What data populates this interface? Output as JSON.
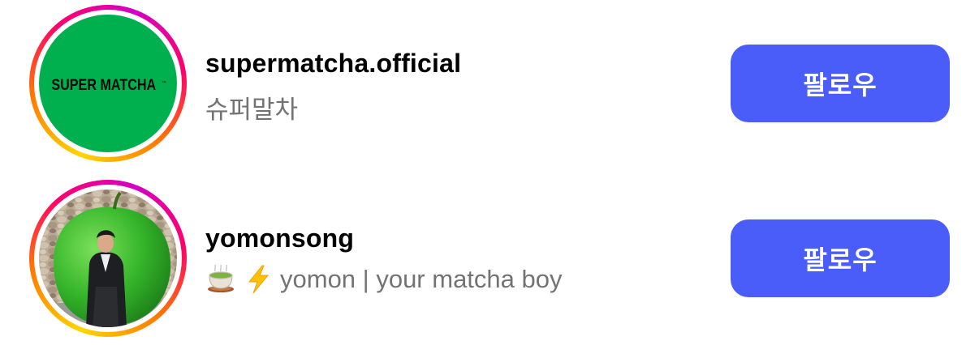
{
  "accounts": [
    {
      "username": "supermatcha.official",
      "subtitle": "슈퍼말차",
      "logo_text": "SUPER MATCHA",
      "logo_mark": "™",
      "avatar_bg": "#00b04f",
      "follow_label": "팔로우"
    },
    {
      "username": "yomonsong",
      "subtitle_emojis": [
        "teacup-icon",
        "lightning-icon"
      ],
      "subtitle": "yomon | your matcha boy",
      "avatar_desc_icon": "profile-photo",
      "follow_label": "팔로우"
    }
  ],
  "colors": {
    "button_bg": "#4a5df9",
    "button_text": "#ffffff",
    "username": "#000000",
    "subtitle": "#737373",
    "story_ring": [
      "#ffd600",
      "#ff7a00",
      "#ff0069",
      "#d300c5"
    ]
  }
}
